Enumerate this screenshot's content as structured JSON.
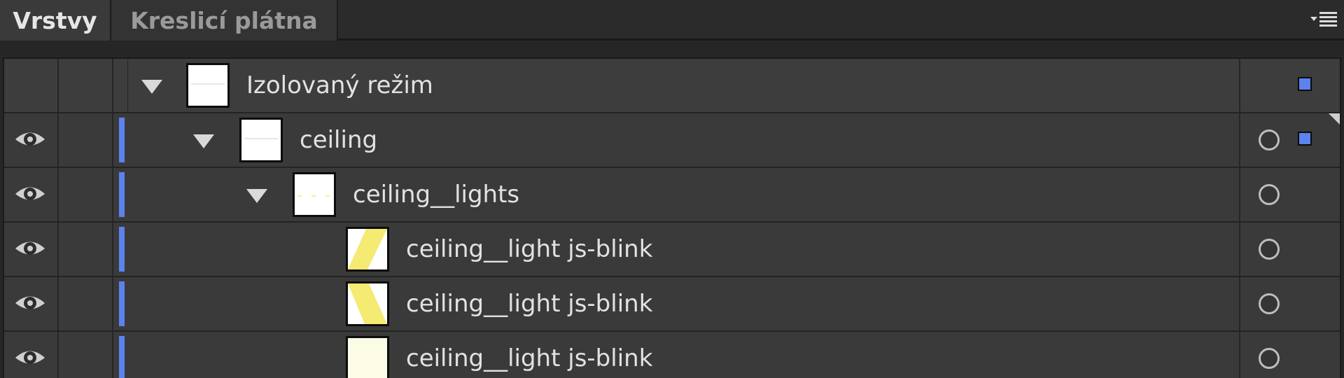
{
  "tabs": {
    "layers": "Vrstvy",
    "artboards": "Kreslicí plátna"
  },
  "icons": {
    "menu": "panel-menu-icon",
    "eye": "eye-icon",
    "disclosure": "disclosure-triangle-icon",
    "target": "target-circle-icon",
    "selection": "selection-square-icon"
  },
  "colors": {
    "layer_color": "#5c82ee",
    "background": "#383838"
  },
  "rows": [
    {
      "name": "Izolovaný režim",
      "visible": false,
      "expanded": true,
      "target": false,
      "selected": true
    },
    {
      "name": "ceiling",
      "visible": true,
      "expanded": true,
      "target": true,
      "selected": true
    },
    {
      "name": "ceiling__lights",
      "visible": true,
      "expanded": true,
      "target": true,
      "selected": false
    },
    {
      "name": "ceiling__light js-blink",
      "visible": true,
      "expanded": false,
      "target": true,
      "selected": false
    },
    {
      "name": "ceiling__light js-blink",
      "visible": true,
      "expanded": false,
      "target": true,
      "selected": false
    },
    {
      "name": "ceiling__light js-blink",
      "visible": true,
      "expanded": false,
      "target": true,
      "selected": false
    }
  ]
}
